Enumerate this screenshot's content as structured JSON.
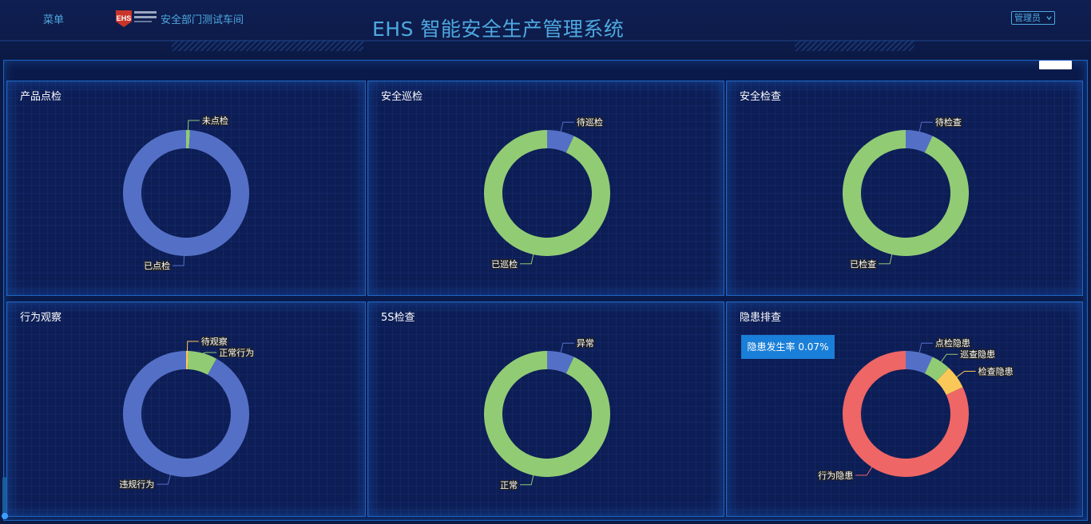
{
  "header": {
    "menu_label": "菜单",
    "logo_text": "EHS",
    "workshop_name": "安全部门测试车间",
    "app_title": "EHS 智能安全生产管理系统",
    "user_role": "管理员"
  },
  "colors": {
    "blue": "#5470c6",
    "green": "#91cc75",
    "yellow": "#fac858",
    "red": "#ee6666",
    "accent": "#4ea8e0"
  },
  "panels": {
    "product_check": {
      "title": "产品点检"
    },
    "safety_patrol": {
      "title": "安全巡检"
    },
    "safety_inspection": {
      "title": "安全检查"
    },
    "behavior_observation": {
      "title": "行为观察"
    },
    "five_s_check": {
      "title": "5S检查"
    },
    "hazard_check": {
      "title": "隐患排查",
      "rate_label": "隐患发生率 0.07%"
    }
  },
  "chart_data": [
    {
      "id": "product_check",
      "type": "pie",
      "categories": [
        "未点检",
        "已点检"
      ],
      "values": [
        1,
        99
      ],
      "colors": [
        "#91cc75",
        "#5470c6"
      ]
    },
    {
      "id": "safety_patrol",
      "type": "pie",
      "categories": [
        "待巡检",
        "已巡检"
      ],
      "values": [
        7,
        93
      ],
      "colors": [
        "#5470c6",
        "#91cc75"
      ]
    },
    {
      "id": "safety_inspection",
      "type": "pie",
      "categories": [
        "待检查",
        "已检查"
      ],
      "values": [
        7,
        93
      ],
      "colors": [
        "#5470c6",
        "#91cc75"
      ]
    },
    {
      "id": "behavior_observation",
      "type": "pie",
      "categories": [
        "待观察",
        "正常行为",
        "违规行为"
      ],
      "values": [
        0.6,
        7.4,
        92
      ],
      "colors": [
        "#fac858",
        "#91cc75",
        "#5470c6"
      ]
    },
    {
      "id": "five_s_check",
      "type": "pie",
      "categories": [
        "异常",
        "正常"
      ],
      "values": [
        7,
        93
      ],
      "colors": [
        "#5470c6",
        "#91cc75"
      ]
    },
    {
      "id": "hazard_check",
      "type": "pie",
      "categories": [
        "点检隐患",
        "巡查隐患",
        "检查隐患",
        "行为隐患"
      ],
      "values": [
        7,
        5,
        6,
        82
      ],
      "colors": [
        "#5470c6",
        "#91cc75",
        "#fac858",
        "#ee6666"
      ]
    }
  ]
}
